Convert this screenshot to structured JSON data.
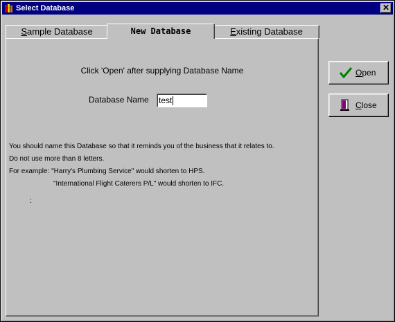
{
  "window": {
    "title": "Select Database",
    "close_glyph": "✕"
  },
  "tabs": [
    {
      "label_first": "S",
      "label_rest": "ample Database",
      "active": false
    },
    {
      "label": "New Database",
      "active": true
    },
    {
      "label_first": "E",
      "label_rest": "xisting Database",
      "active": false
    }
  ],
  "panel": {
    "hint": "Click 'Open' after supplying Database Name",
    "db_label": "Database Name",
    "db_value": "test",
    "info_lines": [
      "You should name this Database so that it reminds you of the business that it relates to.",
      "Do not use more than 8 letters.",
      "For example: \"Harry's Plumbing Service\" would shorten to HPS.",
      "\"International Flight Caterers P/L\" would shorten to IFC."
    ],
    "dots": ":"
  },
  "buttons": {
    "open": {
      "label_first": "O",
      "label_rest": "pen",
      "icon": "checkmark-icon",
      "icon_color": "#008000"
    },
    "close": {
      "label_first": "C",
      "label_rest": "lose",
      "icon": "door-exit-icon",
      "icon_color": "#800080"
    }
  }
}
